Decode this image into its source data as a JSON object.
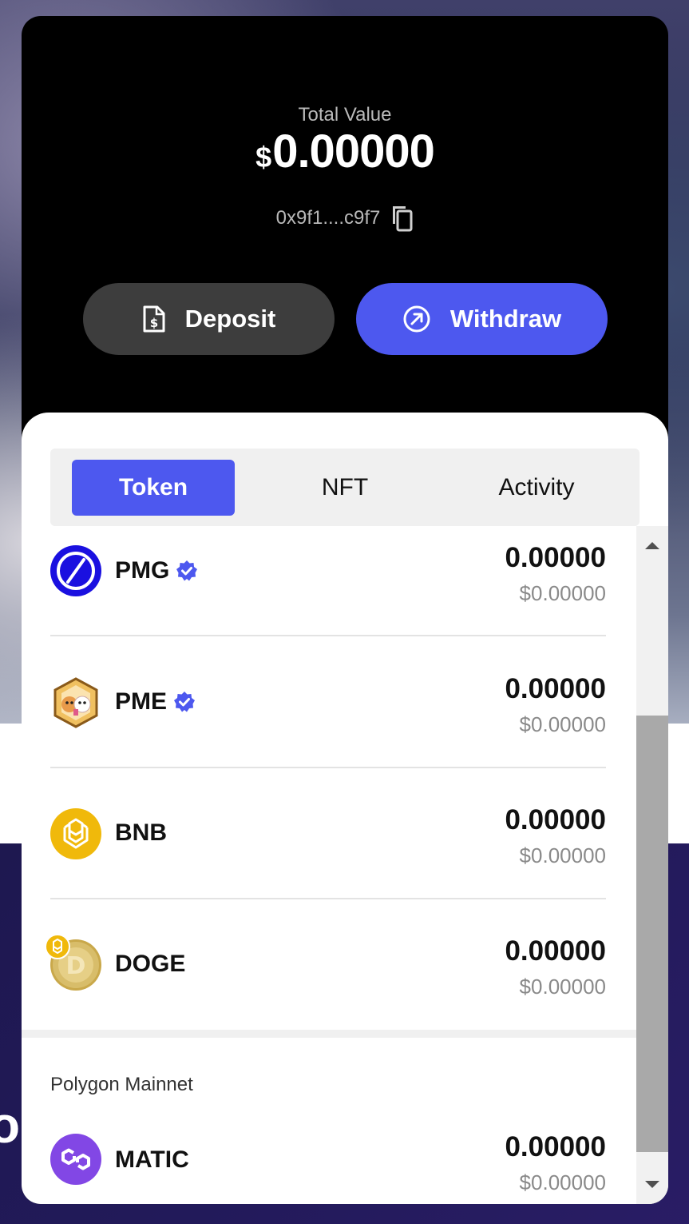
{
  "wallet": {
    "total_label": "Total Value",
    "total_currency": "$",
    "total_amount": "0.00000",
    "address": "0x9f1....c9f7",
    "deposit_label": "Deposit",
    "withdraw_label": "Withdraw"
  },
  "tabs": {
    "token": "Token",
    "nft": "NFT",
    "activity": "Activity"
  },
  "tokens": [
    {
      "name": "PMG",
      "amount": "0.00000",
      "usd": "$0.00000",
      "icon": "pmg-logo-icon",
      "verified": true
    },
    {
      "name": "PME",
      "amount": "0.00000",
      "usd": "$0.00000",
      "icon": "pme-logo-icon",
      "verified": true
    },
    {
      "name": "BNB",
      "amount": "0.00000",
      "usd": "$0.00000",
      "icon": "bnb-logo-icon",
      "verified": false
    },
    {
      "name": "DOGE",
      "amount": "0.00000",
      "usd": "$0.00000",
      "icon": "doge-logo-icon",
      "verified": false
    }
  ],
  "polygon_section": {
    "label": "Polygon Mainnet",
    "token": {
      "name": "MATIC",
      "amount": "0.00000",
      "usd": "$0.00000",
      "icon": "matic-logo-icon"
    }
  },
  "colors": {
    "accent": "#4d58ef",
    "card_bg": "#000000",
    "deposit_bg": "#3d3d3d",
    "verified_badge": "#4d58ef",
    "bnb_yellow": "#f0b90b",
    "matic_purple": "#8247e5",
    "pmg_blue": "#1a10e0"
  },
  "background": {
    "partial_text": "or"
  }
}
